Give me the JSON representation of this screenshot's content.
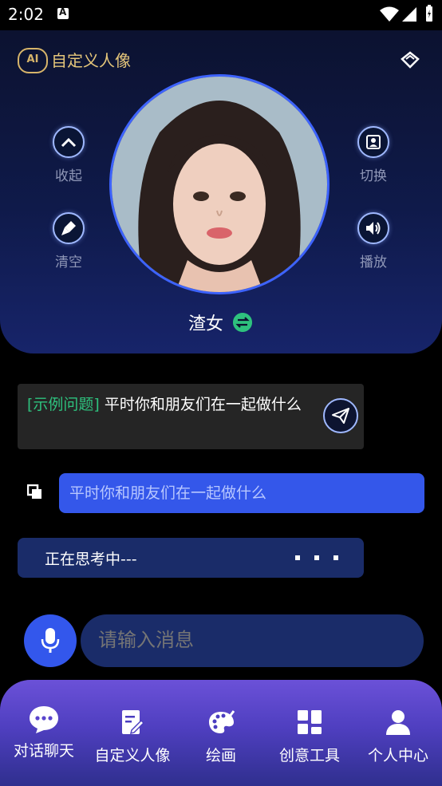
{
  "status": {
    "time": "2:02"
  },
  "header": {
    "badge": "AI",
    "title": "自定义人像",
    "left_buttons": [
      {
        "label": "收起",
        "icon": "chevron-up-icon"
      },
      {
        "label": "清空",
        "icon": "broom-icon"
      }
    ],
    "right_buttons": [
      {
        "label": "切换",
        "icon": "portrait-swap-icon"
      },
      {
        "label": "播放",
        "icon": "speaker-icon"
      }
    ],
    "character_name": "渣女"
  },
  "chat": {
    "example_tag": "[示例问题]",
    "example_text": " 平时你和朋友们在一起做什么",
    "user_message": "平时你和朋友们在一起做什么",
    "thinking_text": "正在思考中---"
  },
  "input": {
    "placeholder": "请输入消息"
  },
  "nav": {
    "items": [
      {
        "label": "对话聊天",
        "icon": "chat-bubble-icon",
        "active": true
      },
      {
        "label": "自定义人像",
        "icon": "edit-document-icon",
        "active": false
      },
      {
        "label": "绘画",
        "icon": "palette-icon",
        "active": false
      },
      {
        "label": "创意工具",
        "icon": "grid-tools-icon",
        "active": false
      },
      {
        "label": "个人中心",
        "icon": "person-icon",
        "active": false
      }
    ]
  },
  "colors": {
    "accent": "#3457ea",
    "gold": "#e5c67a",
    "green": "#2ec27e",
    "nav_top": "#6b51d8"
  }
}
